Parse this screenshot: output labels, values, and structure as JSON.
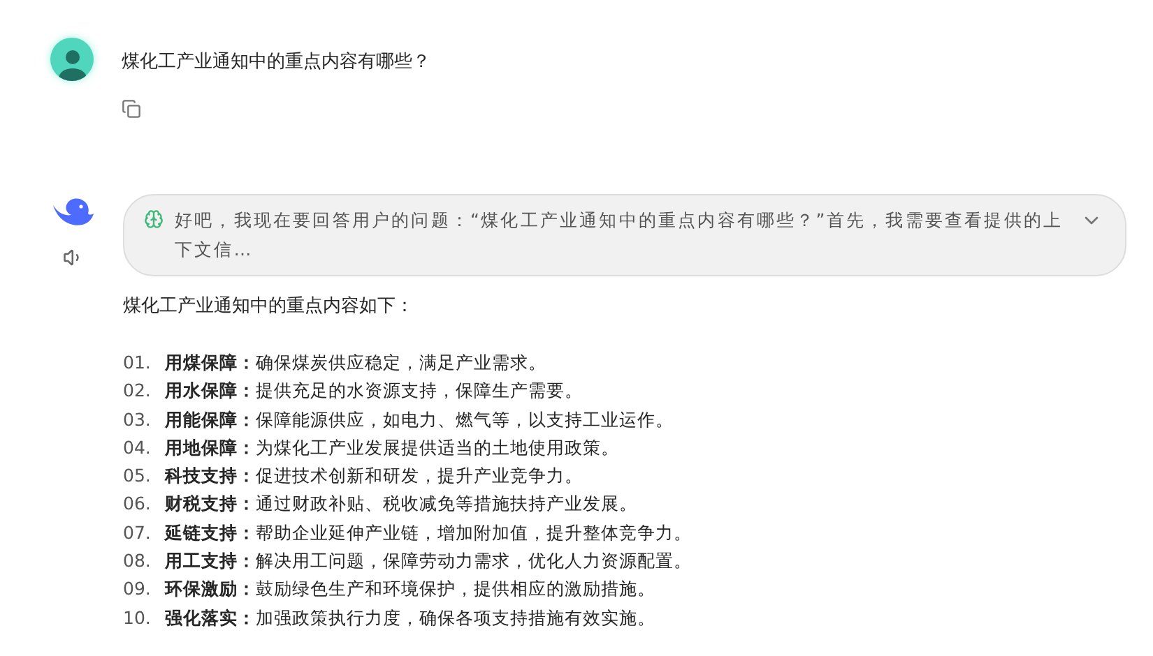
{
  "user_message": {
    "text": "煤化工产业通知中的重点内容有哪些？"
  },
  "assistant": {
    "thinking": {
      "text": "好吧，我现在要回答用户的问题：“煤化工产业通知中的重点内容有哪些？”首先，我需要查看提供的上下文信…",
      "expanded": false
    },
    "intro": "煤化工产业通知中的重点内容如下：",
    "items": [
      {
        "number": "01.",
        "text": "**用煤保障：**确保煤炭供应稳定，满足产业需求。"
      },
      {
        "number": "02.",
        "text": "**用水保障：**提供充足的水资源支持，保障生产需要。"
      },
      {
        "number": "03.",
        "text": "**用能保障：**保障能源供应，如电力、燃气等，以支持工业运作。"
      },
      {
        "number": "04.",
        "text": "**用地保障：**为煤化工产业发展提供适当的土地使用政策。"
      },
      {
        "number": "05.",
        "text": "**科技支持：**促进技术创新和研发，提升产业竞争力。"
      },
      {
        "number": "06.",
        "text": "**财税支持：**通过财政补贴、税收减免等措施扶持产业发展。"
      },
      {
        "number": "07.",
        "text": "**延链支持：**帮助企业延伸产业链，增加附加值，提升整体竞争力。"
      },
      {
        "number": "08.",
        "text": "**用工支持：**解决用工问题，保障劳动力需求，优化人力资源配置。"
      },
      {
        "number": "09.",
        "text": "**环保激励：**鼓励绿色生产和环境保护，提供相应的激励措施。"
      },
      {
        "number": "10.",
        "text": "**强化落实：**加强政策执行力度，确保各项支持措施有效实施。"
      }
    ]
  }
}
